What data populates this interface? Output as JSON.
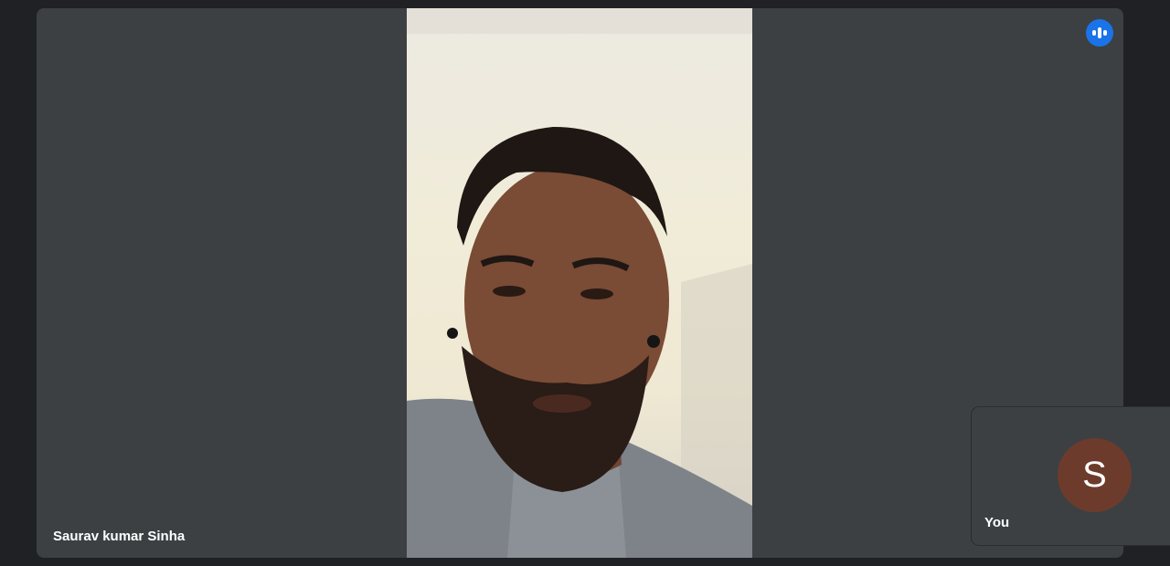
{
  "main_participant": {
    "name": "Saurav kumar Sinha",
    "speaking_icon": "audio-levels-icon"
  },
  "self_view": {
    "avatar_initial": "S",
    "label": "You",
    "avatar_color": "#6d3b2c"
  },
  "colors": {
    "page_background": "#202124",
    "tile_background": "#3c4043",
    "accent": "#1a73e8"
  }
}
